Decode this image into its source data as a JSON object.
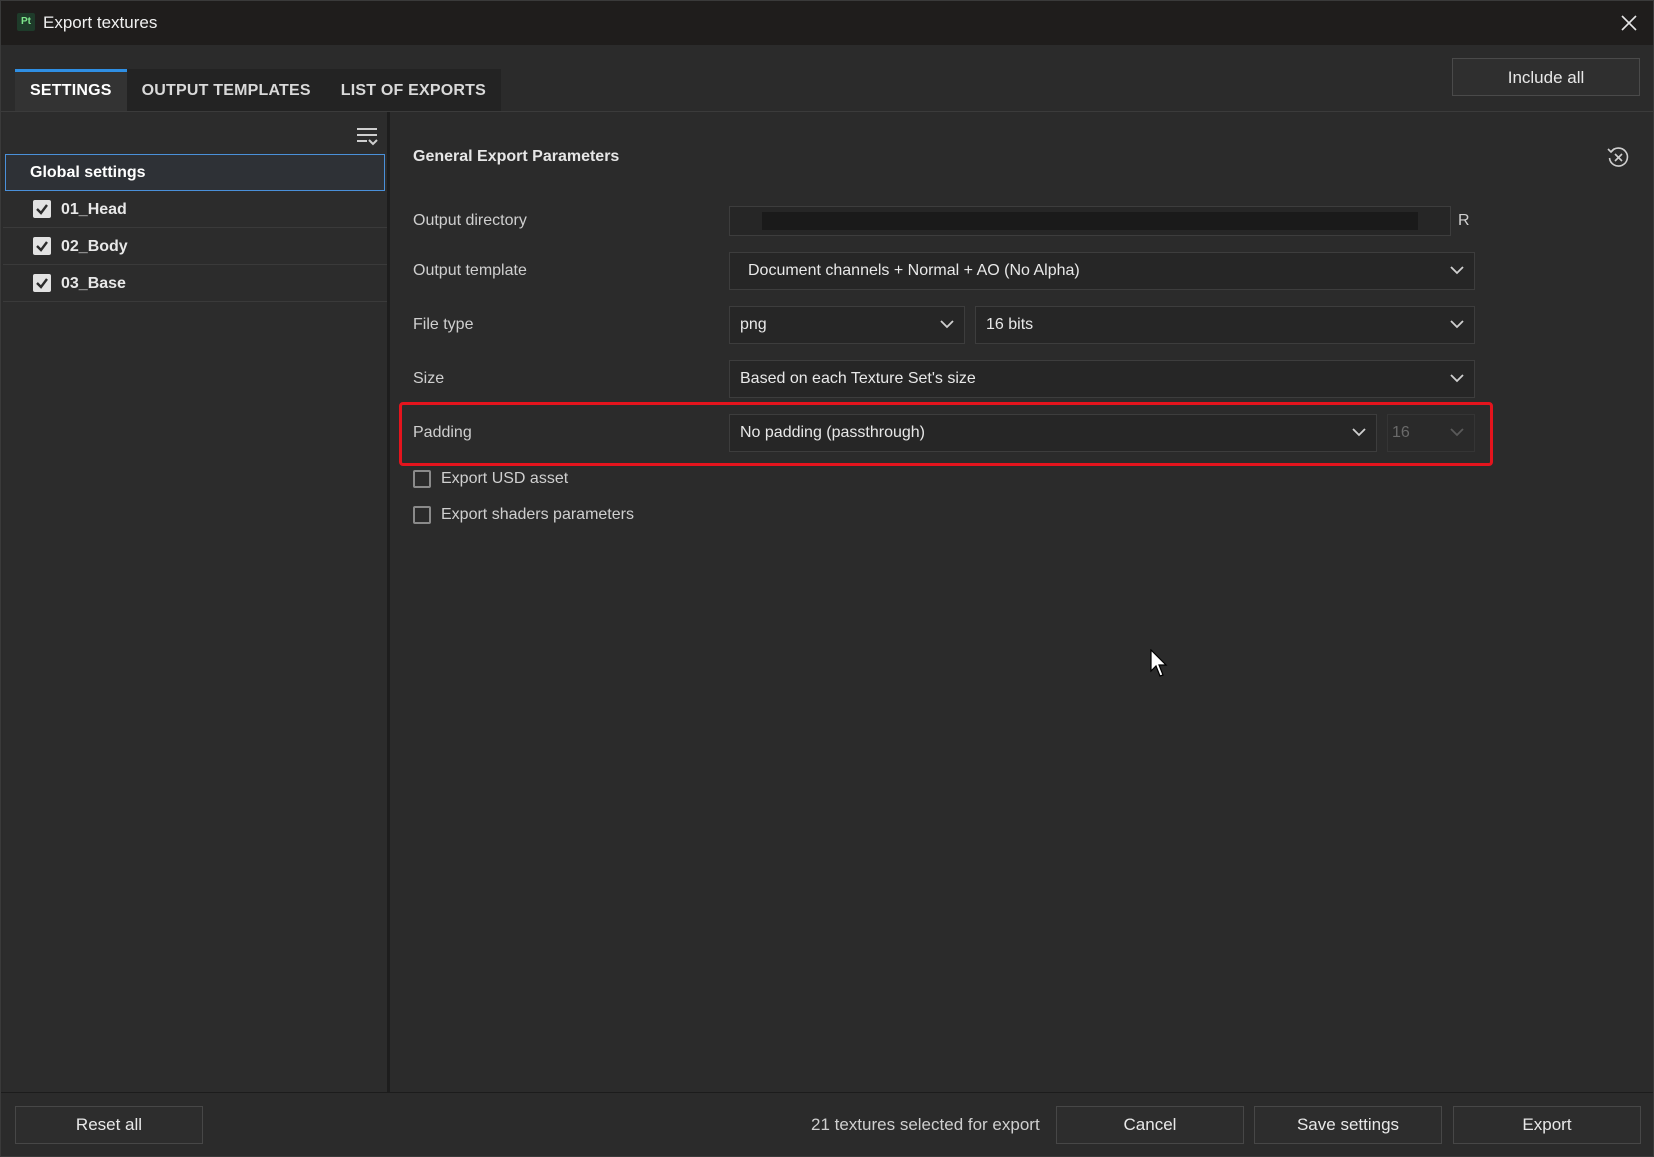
{
  "window": {
    "app_icon_text": "Pt",
    "title": "Export textures"
  },
  "tabs": [
    {
      "label": "SETTINGS",
      "active": true
    },
    {
      "label": "OUTPUT TEMPLATES",
      "active": false
    },
    {
      "label": "LIST OF EXPORTS",
      "active": false
    }
  ],
  "toolbar": {
    "include_all_label": "Include all"
  },
  "sidebar": {
    "global_label": "Global settings",
    "texture_sets": [
      {
        "label": "01_Head",
        "checked": true
      },
      {
        "label": "02_Body",
        "checked": true
      },
      {
        "label": "03_Base",
        "checked": true
      }
    ]
  },
  "main": {
    "section_title": "General Export Parameters",
    "output_directory": {
      "label": "Output directory",
      "suffix": "R"
    },
    "output_template": {
      "label": "Output template",
      "value": "Document channels + Normal + AO (No Alpha)"
    },
    "file_type": {
      "label": "File type",
      "format": "png",
      "bit_depth": "16 bits"
    },
    "size": {
      "label": "Size",
      "value": "Based on each Texture Set's size"
    },
    "padding": {
      "label": "Padding",
      "value": "No padding (passthrough)",
      "dilation": "16"
    },
    "export_usd": {
      "label": "Export USD asset",
      "checked": false
    },
    "export_shaders": {
      "label": "Export shaders parameters",
      "checked": false
    }
  },
  "footer": {
    "reset_all_label": "Reset all",
    "status": "21 textures selected for export",
    "cancel_label": "Cancel",
    "save_label": "Save settings",
    "export_label": "Export"
  },
  "colors": {
    "accent": "#2f8fe4",
    "highlight": "#e4141d",
    "app_icon": "#7ee68c"
  }
}
